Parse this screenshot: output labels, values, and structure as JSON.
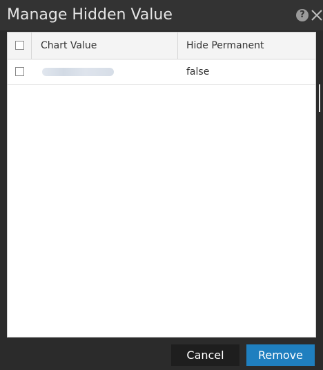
{
  "dialog": {
    "title": "Manage Hidden Value",
    "help_icon": "question-circle-icon",
    "close_icon": "close-icon"
  },
  "table": {
    "columns": [
      "Chart Value",
      "Hide Permanent"
    ],
    "rows": [
      {
        "checked": false,
        "chart_value": "",
        "hide_permanent": "false"
      }
    ]
  },
  "footer": {
    "cancel_label": "Cancel",
    "remove_label": "Remove"
  },
  "colors": {
    "title_bg": "#333333",
    "primary_button": "#1f7fbf",
    "secondary_button": "#1e1e1e"
  }
}
